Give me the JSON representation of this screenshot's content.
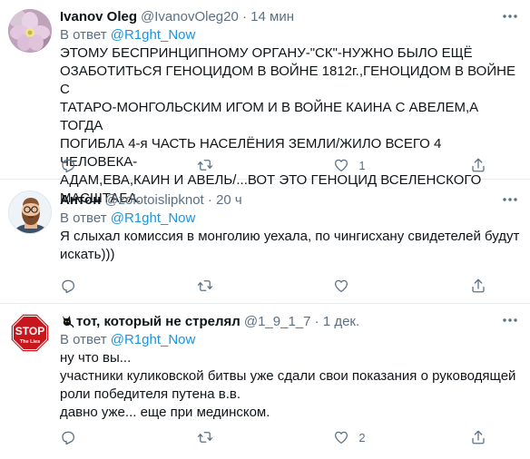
{
  "reply_prefix": "В ответ",
  "tweets": [
    {
      "name": "Ivanov Oleg",
      "handle": "@IvanovOleg20",
      "time": "14 мин",
      "reply_to": "@R1ght_Now",
      "text_lines": [
        "ЭТОМУ БЕСПРИНЦИПНОМУ ОРГАНУ-\"СК\"-НУЖНО БЫЛО ЕЩЁ",
        "ОЗАБОТИТЬСЯ ГЕНОЦИДОМ В ВОЙНЕ 1812г.,ГЕНОЦИДОМ В ВОЙНЕ С",
        "ТАТАРО-МОНГОЛЬСКИМ ИГОМ И В ВОЙНЕ КАИНА С АВЕЛЕМ,А ТОГДА",
        "ПОГИБЛА 4-я ЧАСТЬ НАСЕЛЁНИЯ ЗЕМЛИ/ЖИЛО ВСЕГО 4 ЧЕЛОВЕКА-",
        "АДАМ,ЕВА,КАИН И АВЕЛЬ/...ВОТ ЭТО ГЕНОЦИД ВСЕЛЕНСКОГО",
        "МАСШТАБА."
      ],
      "likes": "1"
    },
    {
      "name": "Антон",
      "handle": "@zolotoislipknot",
      "time": "20 ч",
      "reply_to": "@R1ght_Now",
      "text_lines": [
        "Я слыхал комиссия в монголию уехала, по чингисхану свидетелей будут",
        "искать)))"
      ],
      "likes": ""
    },
    {
      "name": "тот, который не стрелял",
      "handle": "@1_9_1_7",
      "time": "1 дек.",
      "reply_to": "@R1ght_Now",
      "stop_sign": {
        "main": "STOP",
        "sub": "The Lies"
      },
      "text_lines": [
        "ну что вы...",
        "участники куликовской битвы уже сдали свои показания о руководящей",
        "роли победителя путена в.в.",
        "давно уже... еще при мединском."
      ],
      "likes": "2"
    }
  ],
  "icons": {
    "reply": "reply-icon",
    "retweet": "retweet-icon",
    "like": "like-icon",
    "share": "share-icon",
    "more": "more-options-icon",
    "cat": "black-cat-icon"
  },
  "colors": {
    "link": "#1b95e0",
    "muted": "#5b7083",
    "text": "#0f1419",
    "divider": "#ebeef0",
    "stop": "#c8161d"
  }
}
